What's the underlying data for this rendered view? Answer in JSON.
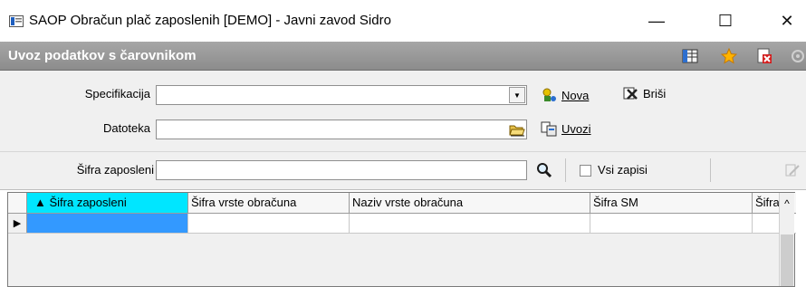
{
  "window": {
    "title": "SAOP Obračun plač zaposlenih  [DEMO] - Javni zavod Sidro",
    "minimize_glyph": "—",
    "maximize_glyph": "☐",
    "close_glyph": "✕"
  },
  "panel": {
    "title": "Uvoz podatkov s čarovnikom"
  },
  "form": {
    "specifikacija_label": "Specifikacija",
    "specifikacija_value": "",
    "datoteka_label": "Datoteka",
    "datoteka_value": "",
    "nova_label": "Nova",
    "brisi_label": "Briši",
    "uvozi_label": "Uvozi"
  },
  "filter": {
    "sifra_label": "Šifra zaposleni",
    "sifra_value": "",
    "vsi_zapisi_label": "Vsi zapisi",
    "vsi_zapisi_checked": false
  },
  "grid": {
    "columns": [
      "▲ Šifra zaposleni",
      "Šifra vrste obračuna",
      "Naziv vrste obračuna",
      "Šifra SM",
      "Šifra S"
    ],
    "scroll_up_glyph": "^",
    "row_indicator": "▶"
  },
  "icons": {
    "header": [
      "grid-view-icon",
      "favorite-star-icon",
      "close-document-icon",
      "settings-icon"
    ],
    "nova": "wizard-new-icon",
    "brisi": "delete-icon",
    "uvozi": "import-icon",
    "browse": "open-folder-icon",
    "search": "magnifier-icon"
  },
  "colors": {
    "header_bg": "#999999",
    "active_column": "#00e6ff",
    "selected_cell": "#3399ff"
  }
}
